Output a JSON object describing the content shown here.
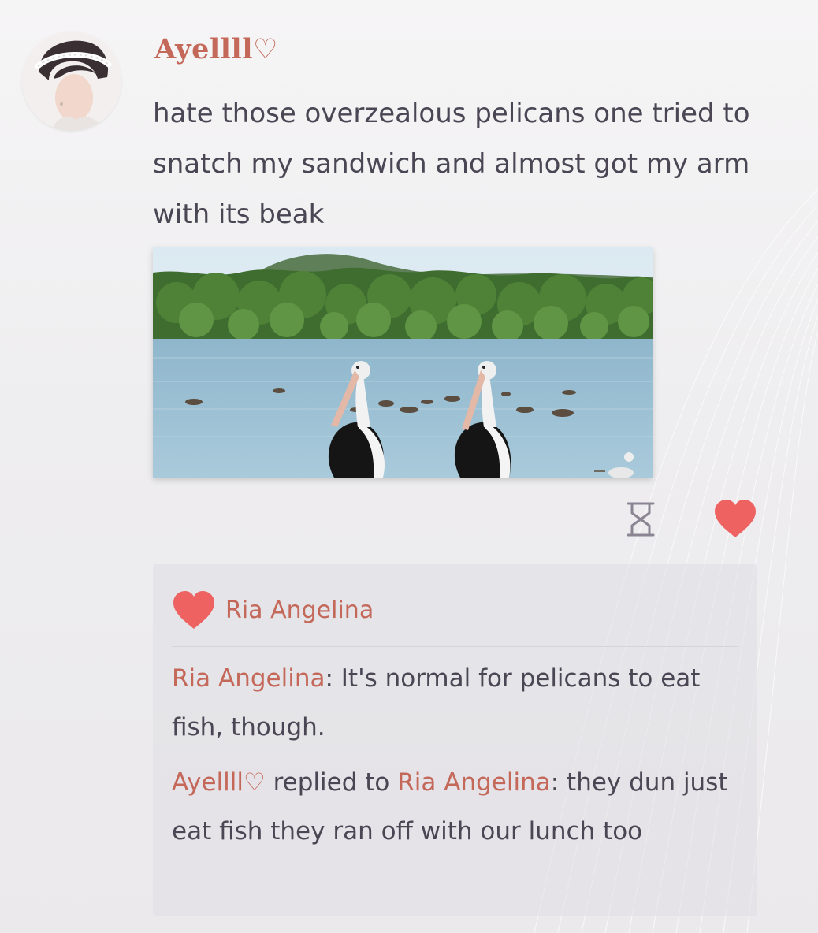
{
  "post": {
    "author": "Ayellll♡",
    "text": "hate those overzealous pelicans one tried to snatch my sandwich and almost got my arm with its beak",
    "photo_icon": "photo-pelicans-lake"
  },
  "actions": {
    "timer_icon": "hourglass-icon",
    "like_icon": "heart-icon"
  },
  "likes": {
    "icon": "heart-icon",
    "names": "Ria Angelina"
  },
  "comments": [
    {
      "author": "Ria Angelina",
      "separator": ":",
      "text": " It's normal for pelicans to eat fish, though."
    },
    {
      "author": "Ayellll♡",
      "replied_text": " replied to ",
      "reply_to": "Ria Angelina",
      "separator": ":",
      "text": " they dun just eat fish they ran off with our lunch too"
    }
  ],
  "colors": {
    "accent": "#c4685a",
    "heart": "#ee6262",
    "text": "#4a4654"
  }
}
